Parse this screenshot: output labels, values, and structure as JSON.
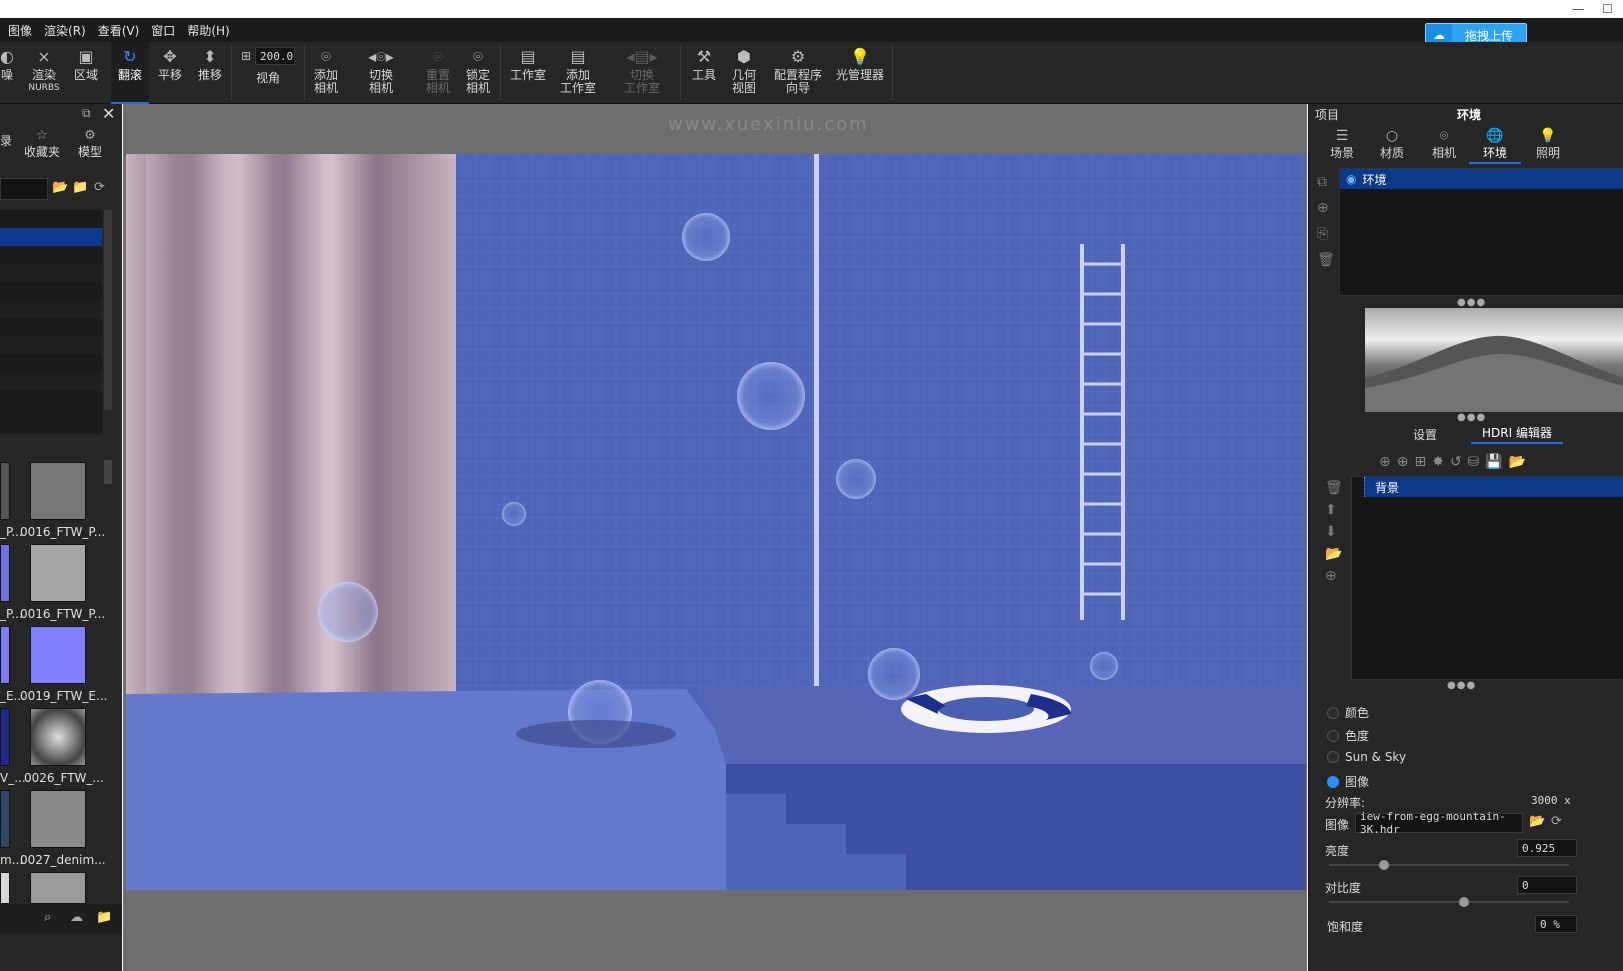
{
  "menu": [
    "图像",
    "渲染(R)",
    "查看(V)",
    "窗口",
    "帮助(H)"
  ],
  "upload_label": "拖拽上传",
  "toolbar": {
    "t0": "噪",
    "t1": "渲染",
    "t1b": "NURBS",
    "t2": "区域",
    "t3": "翻滚",
    "t4": "平移",
    "t5": "推移",
    "fov_value": "200.0",
    "fov_label": "视角",
    "add_cam_a": "添加",
    "add_cam_b": "相机",
    "switch_cam_a": "切换",
    "switch_cam_b": "相机",
    "reset_cam_a": "重置",
    "reset_cam_b": "相机",
    "lock_cam_a": "锁定",
    "lock_cam_b": "相机",
    "studio": "工作室",
    "add_studio_a": "添加",
    "add_studio_b": "工作室",
    "switch_studio_a": "切换",
    "switch_studio_b": "工作室",
    "tools": "工具",
    "geo_a": "几何",
    "geo_b": "视图",
    "config_a": "配置程序",
    "config_b": "向导",
    "light_mgr": "光管理器"
  },
  "left_panel": {
    "tab_a": "录",
    "tab_b": "收藏夹",
    "tab_c": "模型",
    "thumbs": [
      {
        "label_a": "_P...",
        "label_b": "0016_FTW_P..."
      },
      {
        "label_a": "_P...",
        "label_b": "0016_FTW_P..."
      },
      {
        "label_a": "_E...",
        "label_b": "0019_FTW_E..."
      },
      {
        "label_a": "V_...",
        "label_b": "0026_FTW_..."
      },
      {
        "label_a": "m...",
        "label_b": "0027_denim..."
      }
    ]
  },
  "right_panel": {
    "header_left": "项目",
    "header_title": "环境",
    "tabs": [
      "场景",
      "材质",
      "相机",
      "环境",
      "照明"
    ],
    "env_item": "环境",
    "subtabs": [
      "设置",
      "HDRI 编辑器"
    ],
    "layer_item": "背景",
    "radios": [
      "颜色",
      "色度",
      "Sun & Sky",
      "图像"
    ],
    "resolution_label": "分辨率:",
    "resolution_value": "3000 x",
    "image_label": "图像",
    "image_value": "iew-from-egg-mountain-3K.hdr",
    "brightness_label": "亮度",
    "brightness_value": "0.925",
    "contrast_label": "对比度",
    "contrast_value": "0",
    "saturation_label": "饱和度",
    "saturation_value": "0 %"
  },
  "watermark": "www.xuexiniu.com"
}
